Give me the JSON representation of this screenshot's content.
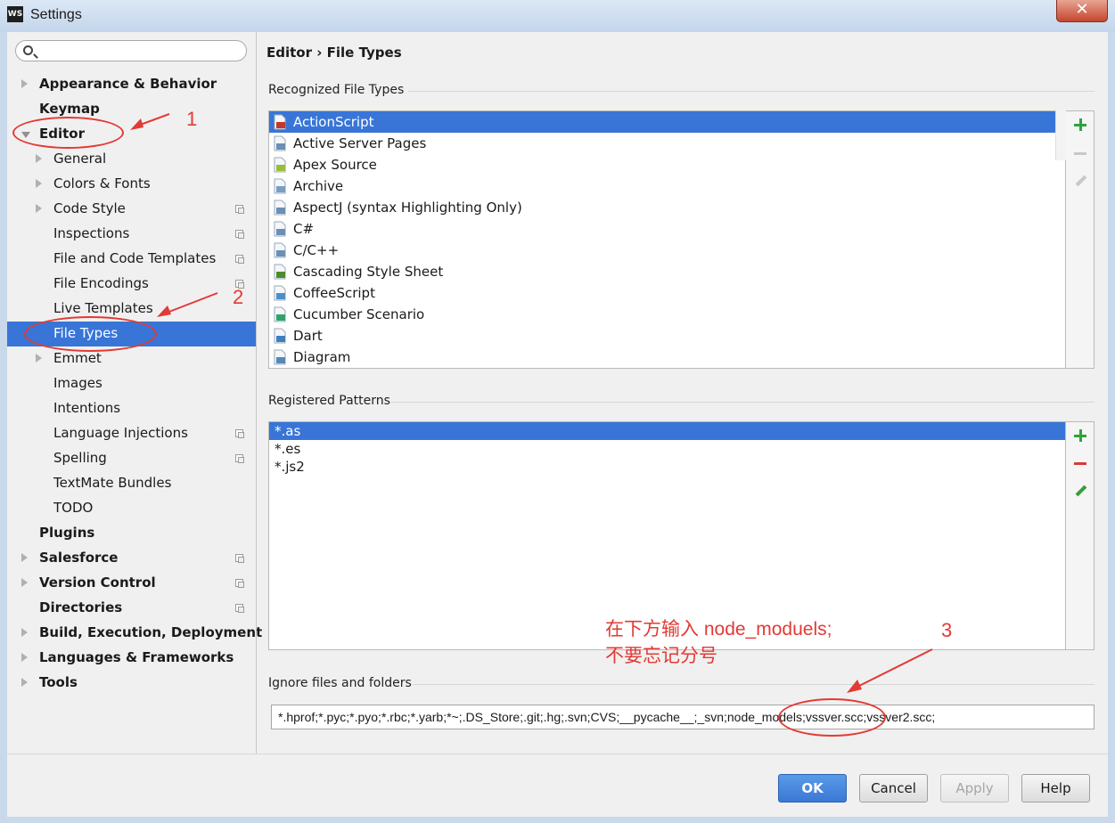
{
  "window": {
    "title": "Settings",
    "app_icon_text": "WS",
    "close_glyph": "✕"
  },
  "search": {
    "placeholder": ""
  },
  "breadcrumb": {
    "parent": "Editor",
    "separator": "›",
    "current": "File Types"
  },
  "sidebar": {
    "items": [
      {
        "label": "Appearance & Behavior",
        "bold": true,
        "level": 0,
        "arrow": "right",
        "config": false
      },
      {
        "label": "Keymap",
        "bold": true,
        "level": 0,
        "arrow": "none",
        "config": false
      },
      {
        "label": "Editor",
        "bold": true,
        "level": 0,
        "arrow": "down",
        "config": false
      },
      {
        "label": "General",
        "bold": false,
        "level": 1,
        "arrow": "right",
        "config": false
      },
      {
        "label": "Colors & Fonts",
        "bold": false,
        "level": 1,
        "arrow": "right",
        "config": false
      },
      {
        "label": "Code Style",
        "bold": false,
        "level": 1,
        "arrow": "right",
        "config": true
      },
      {
        "label": "Inspections",
        "bold": false,
        "level": 1,
        "arrow": "none",
        "config": true
      },
      {
        "label": "File and Code Templates",
        "bold": false,
        "level": 1,
        "arrow": "none",
        "config": true
      },
      {
        "label": "File Encodings",
        "bold": false,
        "level": 1,
        "arrow": "none",
        "config": true
      },
      {
        "label": "Live Templates",
        "bold": false,
        "level": 1,
        "arrow": "none",
        "config": false
      },
      {
        "label": "File Types",
        "bold": false,
        "level": 1,
        "arrow": "none",
        "config": false,
        "selected": true
      },
      {
        "label": "Emmet",
        "bold": false,
        "level": 1,
        "arrow": "right",
        "config": false
      },
      {
        "label": "Images",
        "bold": false,
        "level": 1,
        "arrow": "none",
        "config": false
      },
      {
        "label": "Intentions",
        "bold": false,
        "level": 1,
        "arrow": "none",
        "config": false
      },
      {
        "label": "Language Injections",
        "bold": false,
        "level": 1,
        "arrow": "none",
        "config": true
      },
      {
        "label": "Spelling",
        "bold": false,
        "level": 1,
        "arrow": "none",
        "config": true
      },
      {
        "label": "TextMate Bundles",
        "bold": false,
        "level": 1,
        "arrow": "none",
        "config": false
      },
      {
        "label": "TODO",
        "bold": false,
        "level": 1,
        "arrow": "none",
        "config": false
      },
      {
        "label": "Plugins",
        "bold": true,
        "level": 0,
        "arrow": "none",
        "config": false
      },
      {
        "label": "Salesforce",
        "bold": true,
        "level": 0,
        "arrow": "right",
        "config": true
      },
      {
        "label": "Version Control",
        "bold": true,
        "level": 0,
        "arrow": "right",
        "config": true
      },
      {
        "label": "Directories",
        "bold": true,
        "level": 0,
        "arrow": "none",
        "config": true
      },
      {
        "label": "Build, Execution, Deployment",
        "bold": true,
        "level": 0,
        "arrow": "right",
        "config": false
      },
      {
        "label": "Languages & Frameworks",
        "bold": true,
        "level": 0,
        "arrow": "right",
        "config": false
      },
      {
        "label": "Tools",
        "bold": true,
        "level": 0,
        "arrow": "right",
        "config": false
      }
    ]
  },
  "recognized": {
    "title": "Recognized File Types",
    "items": [
      {
        "label": "ActionScript",
        "icon": "actionscript-icon",
        "color": "#c0392b",
        "selected": true
      },
      {
        "label": "Active Server Pages",
        "icon": "asp-file-icon",
        "color": "#6b8fb5"
      },
      {
        "label": "Apex Source",
        "icon": "apex-icon",
        "color": "#9bbb3a"
      },
      {
        "label": "Archive",
        "icon": "archive-icon",
        "color": "#7a9ec2"
      },
      {
        "label": "AspectJ (syntax Highlighting Only)",
        "icon": "aspectj-file-icon",
        "color": "#6b8fb5"
      },
      {
        "label": "C#",
        "icon": "csharp-file-icon",
        "color": "#6b8fb5"
      },
      {
        "label": "C/C++",
        "icon": "cpp-file-icon",
        "color": "#6b8fb5"
      },
      {
        "label": "Cascading Style Sheet",
        "icon": "css-icon",
        "color": "#4c8c2f"
      },
      {
        "label": "CoffeeScript",
        "icon": "coffeescript-icon",
        "color": "#4a90c8"
      },
      {
        "label": "Cucumber Scenario",
        "icon": "cucumber-icon",
        "color": "#2fa36b"
      },
      {
        "label": "Dart",
        "icon": "dart-icon",
        "color": "#3f7fbf"
      },
      {
        "label": "Diagram",
        "icon": "diagram-icon",
        "color": "#5588bb"
      }
    ]
  },
  "patterns": {
    "title": "Registered Patterns",
    "items": [
      {
        "label": "*.as",
        "selected": true
      },
      {
        "label": "*.es"
      },
      {
        "label": "*.js2"
      }
    ]
  },
  "ignore": {
    "title": "Ignore files and folders",
    "value": "*.hprof;*.pyc;*.pyo;*.rbc;*.yarb;*~;.DS_Store;.git;.hg;.svn;CVS;__pycache__;_svn;node_models;vssver.scc;vssver2.scc;"
  },
  "buttons": {
    "ok": "OK",
    "cancel": "Cancel",
    "apply": "Apply",
    "help": "Help"
  },
  "annotations": {
    "n1": "1",
    "n2": "2",
    "n3": "3",
    "note_line1": "在下方输入 node_moduels;",
    "note_line2": "不要忘记分号"
  },
  "colors": {
    "selection": "#3875d7",
    "annotation": "#e23a34",
    "add": "#2fa33b",
    "remove": "#d93a3a"
  }
}
